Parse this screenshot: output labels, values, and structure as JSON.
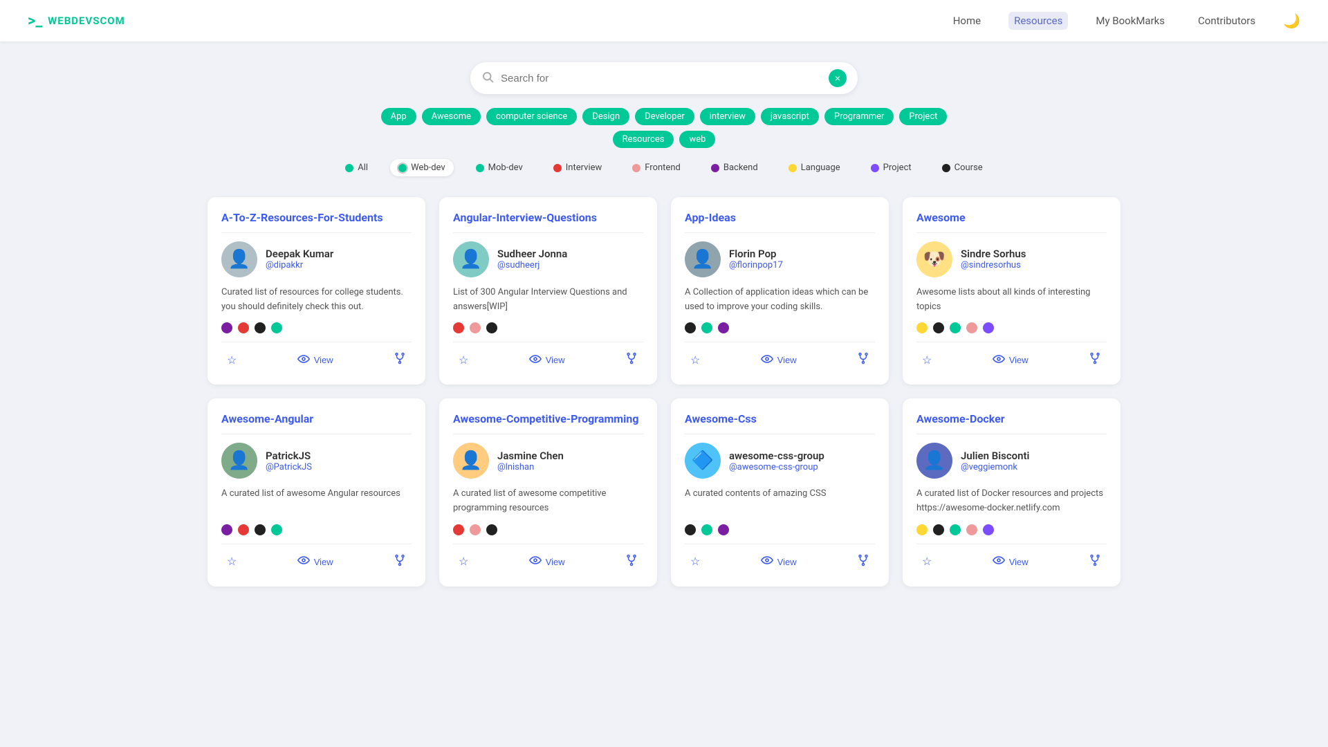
{
  "header": {
    "logo_icon": ">_",
    "logo_text": "WEBDEVSCOM",
    "nav": [
      {
        "label": "Home",
        "active": false
      },
      {
        "label": "Resources",
        "active": true
      },
      {
        "label": "My BookMarks",
        "active": false
      },
      {
        "label": "Contributors",
        "active": false
      }
    ],
    "moon_icon": "🌙"
  },
  "search": {
    "placeholder": "Search for",
    "clear_icon": "×"
  },
  "tags": [
    "App",
    "Awesome",
    "computer science",
    "Design",
    "Developer",
    "interview",
    "javascript",
    "Programmer",
    "Project",
    "Resources",
    "web"
  ],
  "filters": [
    {
      "label": "All",
      "color": "#00c896",
      "active": false
    },
    {
      "label": "Web-dev",
      "color": "#00c896",
      "active": true
    },
    {
      "label": "Mob-dev",
      "color": "#00c896",
      "active": false
    },
    {
      "label": "Interview",
      "color": "#e53935",
      "active": false
    },
    {
      "label": "Frontend",
      "color": "#ef9a9a",
      "active": false
    },
    {
      "label": "Backend",
      "color": "#7b1fa2",
      "active": false
    },
    {
      "label": "Language",
      "color": "#fdd835",
      "active": false
    },
    {
      "label": "Project",
      "color": "#7c4dff",
      "active": false
    },
    {
      "label": "Course",
      "color": "#212121",
      "active": false
    }
  ],
  "cards": [
    {
      "title": "A-To-Z-Resources-For-Students",
      "author_name": "Deepak Kumar",
      "author_handle": "@dipakkr",
      "avatar_emoji": "👤",
      "avatar_bg": "#b0bec5",
      "description": "Curated list of resources for college students. you should definitely check this out.",
      "tag_colors": [
        "#7b1fa2",
        "#e53935",
        "#212121",
        "#00c896"
      ]
    },
    {
      "title": "Angular-Interview-Questions",
      "author_name": "Sudheer Jonna",
      "author_handle": "@sudheerj",
      "avatar_emoji": "👤",
      "avatar_bg": "#80cbc4",
      "description": "List of 300 Angular Interview Questions and answers[WIP]",
      "tag_colors": [
        "#e53935",
        "#ef9a9a",
        "#212121"
      ]
    },
    {
      "title": "App-Ideas",
      "author_name": "Florin Pop",
      "author_handle": "@florinpop17",
      "avatar_emoji": "👤",
      "avatar_bg": "#90a4ae",
      "description": "A Collection of application ideas which can be used to improve your coding skills.",
      "tag_colors": [
        "#212121",
        "#00c896",
        "#7b1fa2"
      ]
    },
    {
      "title": "Awesome",
      "author_name": "Sindre Sorhus",
      "author_handle": "@sindresorhus",
      "avatar_emoji": "🐶",
      "avatar_bg": "#ffe082",
      "description": "Awesome lists about all kinds of interesting topics",
      "tag_colors": [
        "#fdd835",
        "#212121",
        "#00c896",
        "#ef9a9a",
        "#7c4dff"
      ]
    },
    {
      "title": "Awesome-Angular",
      "author_name": "PatrickJS",
      "author_handle": "@PatrickJS",
      "avatar_emoji": "👤",
      "avatar_bg": "#80ab8a",
      "description": "A curated list of awesome Angular resources",
      "tag_colors": [
        "#7b1fa2",
        "#e53935",
        "#212121",
        "#00c896"
      ]
    },
    {
      "title": "Awesome-Competitive-Programming",
      "author_name": "Jasmine Chen",
      "author_handle": "@lnishan",
      "avatar_emoji": "👤",
      "avatar_bg": "#ffcc80",
      "description": "A curated list of awesome competitive programming resources",
      "tag_colors": [
        "#e53935",
        "#ef9a9a",
        "#212121"
      ]
    },
    {
      "title": "Awesome-Css",
      "author_name": "awesome-css-group",
      "author_handle": "@awesome-css-group",
      "avatar_emoji": "🔷",
      "avatar_bg": "#4fc3f7",
      "description": "A curated contents of amazing CSS",
      "tag_colors": [
        "#212121",
        "#00c896",
        "#7b1fa2"
      ]
    },
    {
      "title": "Awesome-Docker",
      "author_name": "Julien Bisconti",
      "author_handle": "@veggiemonk",
      "avatar_emoji": "👤",
      "avatar_bg": "#5c6bc0",
      "description": "A curated list of Docker resources and projects https://awesome-docker.netlify.com",
      "tag_colors": [
        "#fdd835",
        "#212121",
        "#00c896",
        "#ef9a9a",
        "#7c4dff"
      ]
    }
  ],
  "actions": {
    "bookmark_icon": "☆",
    "view_icon": "👁",
    "view_label": "View",
    "fork_icon": "⑂"
  }
}
